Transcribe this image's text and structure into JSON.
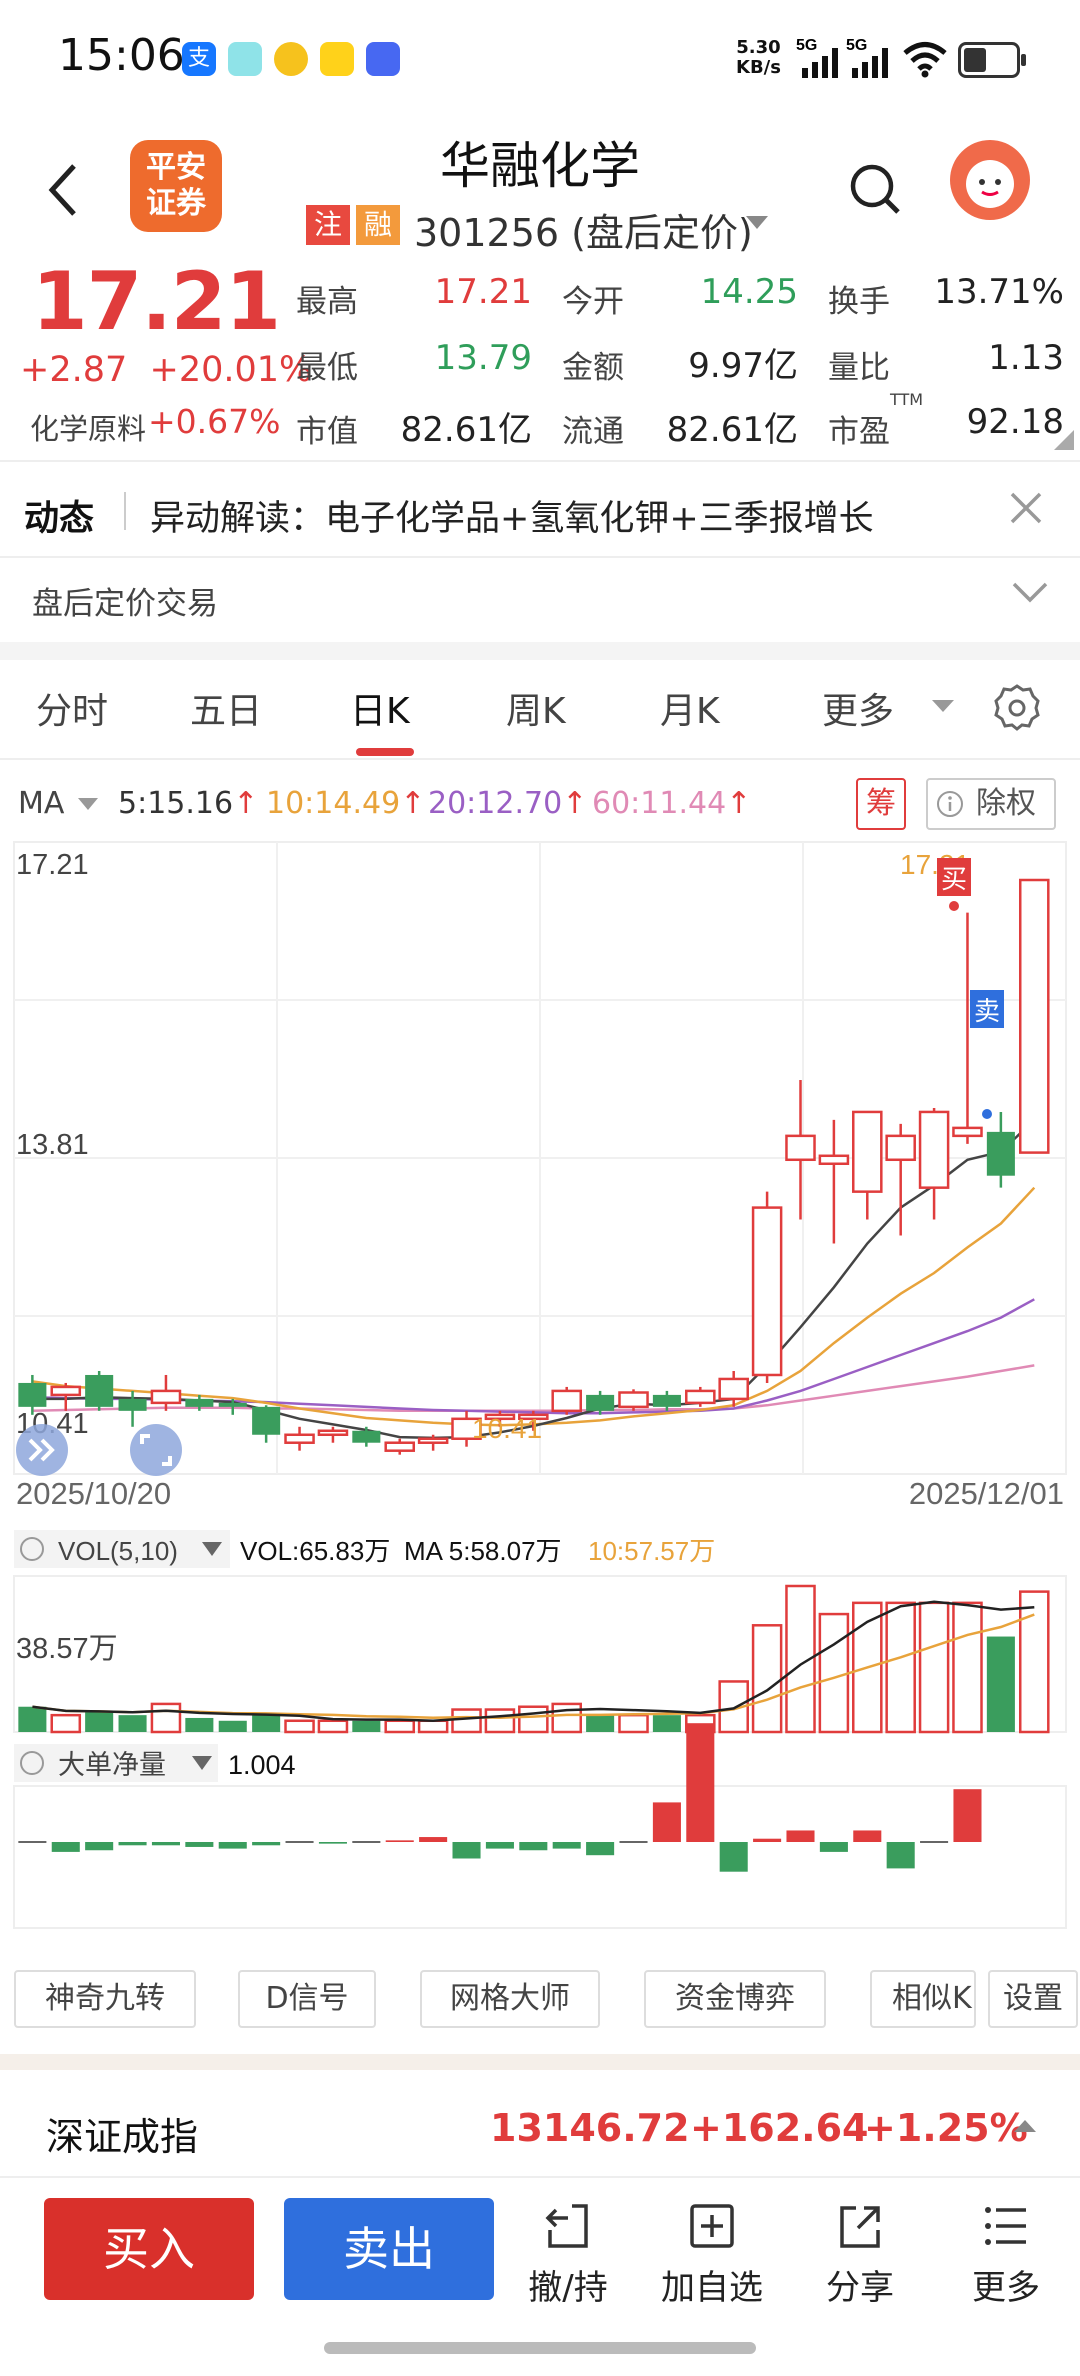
{
  "status_bar": {
    "time": "15:06",
    "net_speed_value": "5.30",
    "net_speed_unit": "KB/s",
    "signal1": "5G",
    "signal2": "5G",
    "app_icons": [
      "alipay-icon",
      "chat-app-icon",
      "yellow-app-icon",
      "guoguo-app-icon",
      "vivo-app-icon"
    ]
  },
  "header": {
    "logo_line1": "平安",
    "logo_line2": "证券",
    "stock_name": "华融化学",
    "tag_margin": "注",
    "tag_financing": "融",
    "stock_code": "301256 (盘后定价)"
  },
  "quote": {
    "price": "17.21",
    "change": "+2.87",
    "change_pct": "+20.01%",
    "sector_label": "化学原料",
    "sector_change": "+0.67%",
    "rows": [
      [
        {
          "label": "最高",
          "value": "17.21",
          "color": "#e03c3c"
        },
        {
          "label": "今开",
          "value": "14.25",
          "color": "#2f9e5a"
        },
        {
          "label": "换手",
          "value": "13.71%",
          "color": "#222"
        }
      ],
      [
        {
          "label": "最低",
          "value": "13.79",
          "color": "#2f9e5a"
        },
        {
          "label": "金额",
          "value": "9.97亿",
          "color": "#222"
        },
        {
          "label": "量比",
          "value": "1.13",
          "color": "#222"
        }
      ],
      [
        {
          "label": "市值",
          "value": "82.61亿",
          "color": "#222"
        },
        {
          "label": "流通",
          "value": "82.61亿",
          "color": "#222"
        },
        {
          "label": "市盈",
          "sup": "TTM",
          "value": "92.18",
          "color": "#222"
        }
      ]
    ]
  },
  "news": {
    "title": "动态",
    "text": "异动解读：电子化学品+氢氧化钾+三季报增长",
    "after_hours": "盘后定价交易"
  },
  "tabs": [
    "分时",
    "五日",
    "日K",
    "周K",
    "月K",
    "更多"
  ],
  "active_tab": "日K",
  "ma_bar": {
    "label": "MA",
    "ma5": "5:15.16",
    "ma10": "10:14.49",
    "ma20": "20:12.70",
    "ma60": "60:11.44",
    "arrow": "↑",
    "chip_button": "筹",
    "fq_button": "除权"
  },
  "chart_data": {
    "type": "candlestick",
    "price_labels": {
      "top": "17.21",
      "mid": "13.81",
      "low": "10.41",
      "max_marker": "17.21",
      "min_marker": "10.41"
    },
    "date_start": "2025/10/20",
    "date_end": "2025/12/01",
    "ylim": [
      10.41,
      17.21
    ],
    "candles": [
      {
        "o": 10.9,
        "h": 11.0,
        "l": 10.5,
        "c": 10.6
      },
      {
        "o": 10.75,
        "h": 10.9,
        "l": 10.55,
        "c": 10.85
      },
      {
        "o": 11.0,
        "h": 11.05,
        "l": 10.55,
        "c": 10.6
      },
      {
        "o": 10.7,
        "h": 10.8,
        "l": 10.35,
        "c": 10.55
      },
      {
        "o": 10.65,
        "h": 11.0,
        "l": 10.55,
        "c": 10.8
      },
      {
        "o": 10.7,
        "h": 10.75,
        "l": 10.55,
        "c": 10.6
      },
      {
        "o": 10.65,
        "h": 10.7,
        "l": 10.5,
        "c": 10.6
      },
      {
        "o": 10.6,
        "h": 10.62,
        "l": 10.15,
        "c": 10.25
      },
      {
        "o": 10.15,
        "h": 10.35,
        "l": 10.05,
        "c": 10.25
      },
      {
        "o": 10.25,
        "h": 10.35,
        "l": 10.15,
        "c": 10.3
      },
      {
        "o": 10.3,
        "h": 10.35,
        "l": 10.1,
        "c": 10.15
      },
      {
        "o": 10.05,
        "h": 10.2,
        "l": 10.0,
        "c": 10.15
      },
      {
        "o": 10.15,
        "h": 10.25,
        "l": 10.05,
        "c": 10.2
      },
      {
        "o": 10.2,
        "h": 10.55,
        "l": 10.1,
        "c": 10.45
      },
      {
        "o": 10.45,
        "h": 10.55,
        "l": 10.35,
        "c": 10.5
      },
      {
        "o": 10.45,
        "h": 10.55,
        "l": 10.3,
        "c": 10.5
      },
      {
        "o": 10.55,
        "h": 10.85,
        "l": 10.5,
        "c": 10.8
      },
      {
        "o": 10.75,
        "h": 10.8,
        "l": 10.5,
        "c": 10.55
      },
      {
        "o": 10.6,
        "h": 10.82,
        "l": 10.55,
        "c": 10.78
      },
      {
        "o": 10.75,
        "h": 10.8,
        "l": 10.55,
        "c": 10.6
      },
      {
        "o": 10.65,
        "h": 10.85,
        "l": 10.6,
        "c": 10.8
      },
      {
        "o": 10.7,
        "h": 11.05,
        "l": 10.6,
        "c": 10.95
      },
      {
        "o": 11.0,
        "h": 13.3,
        "l": 10.9,
        "c": 13.1
      },
      {
        "o": 13.7,
        "h": 14.7,
        "l": 12.95,
        "c": 14.0
      },
      {
        "o": 13.65,
        "h": 14.2,
        "l": 12.65,
        "c": 13.75
      },
      {
        "o": 13.3,
        "h": 14.3,
        "l": 12.95,
        "c": 14.3
      },
      {
        "o": 13.7,
        "h": 14.15,
        "l": 12.75,
        "c": 14.0
      },
      {
        "o": 13.35,
        "h": 14.35,
        "l": 12.95,
        "c": 14.3
      },
      {
        "o": 14.0,
        "h": 16.8,
        "l": 13.9,
        "c": 14.1
      },
      {
        "o": 14.05,
        "h": 14.3,
        "l": 13.35,
        "c": 13.5
      },
      {
        "o": 13.79,
        "h": 17.21,
        "l": 13.79,
        "c": 17.21
      }
    ],
    "ma5": [
      10.7,
      10.7,
      10.72,
      10.71,
      10.7,
      10.68,
      10.66,
      10.56,
      10.45,
      10.38,
      10.31,
      10.22,
      10.21,
      10.22,
      10.28,
      10.36,
      10.46,
      10.58,
      10.64,
      10.62,
      10.65,
      10.7,
      11.12,
      11.6,
      12.1,
      12.65,
      13.1,
      13.38,
      13.7,
      13.8,
      14.2
    ],
    "ma10": [
      10.92,
      10.86,
      10.83,
      10.8,
      10.77,
      10.74,
      10.71,
      10.65,
      10.58,
      10.52,
      10.46,
      10.43,
      10.4,
      10.38,
      10.37,
      10.38,
      10.4,
      10.43,
      10.48,
      10.52,
      10.56,
      10.62,
      10.8,
      11.05,
      11.4,
      11.72,
      12.02,
      12.28,
      12.6,
      12.9,
      13.35
    ],
    "ma20": [
      10.72,
      10.71,
      10.7,
      10.7,
      10.69,
      10.68,
      10.67,
      10.66,
      10.64,
      10.62,
      10.6,
      10.58,
      10.56,
      10.55,
      10.54,
      10.53,
      10.52,
      10.52,
      10.53,
      10.54,
      10.55,
      10.58,
      10.68,
      10.8,
      10.95,
      11.1,
      11.25,
      11.4,
      11.55,
      11.72,
      11.95
    ],
    "ma60": [
      10.55,
      10.56,
      10.57,
      10.58,
      10.59,
      10.59,
      10.59,
      10.58,
      10.58,
      10.57,
      10.56,
      10.55,
      10.55,
      10.55,
      10.55,
      10.55,
      10.55,
      10.56,
      10.56,
      10.57,
      10.57,
      10.58,
      10.62,
      10.68,
      10.74,
      10.8,
      10.86,
      10.92,
      10.98,
      11.05,
      11.12
    ],
    "volume_label": "VOL(5,10)",
    "volume_values": {
      "vol": "VOL:65.83万",
      "ma5": "MA 5:58.07万",
      "ma10": "10:57.57万"
    },
    "volume_axis": "38.57万",
    "volume": [
      9,
      6,
      7,
      6,
      10,
      5,
      4,
      6,
      4,
      4,
      4,
      4,
      4,
      8,
      8,
      9,
      10,
      6,
      6,
      6,
      6,
      18,
      38,
      52,
      42,
      46,
      46,
      46,
      46,
      34,
      50
    ],
    "net_flow_label": "大单净量",
    "net_flow_value": "1.004",
    "net_flow": [
      0,
      -0.3,
      -0.25,
      -0.1,
      -0.1,
      -0.15,
      -0.2,
      -0.1,
      0,
      -0.05,
      0,
      0.05,
      0.15,
      -0.5,
      -0.2,
      -0.25,
      -0.2,
      -0.4,
      0,
      1.2,
      3.6,
      -0.9,
      0.1,
      0.35,
      -0.3,
      0.35,
      -0.8,
      0,
      1.6
    ]
  },
  "bottom_tools": [
    "神奇九转",
    "D信号",
    "网格大师",
    "资金博弈",
    "相似K",
    "设置"
  ],
  "index": {
    "name": "深证成指",
    "value": "13146.72",
    "change": "+162.64",
    "pct": "+1.25%"
  },
  "actions": {
    "buy": "买入",
    "sell": "卖出"
  },
  "nav": [
    "撤/持",
    "加自选",
    "分享",
    "更多"
  ],
  "markers": {
    "buy": "买",
    "sell": "卖"
  }
}
